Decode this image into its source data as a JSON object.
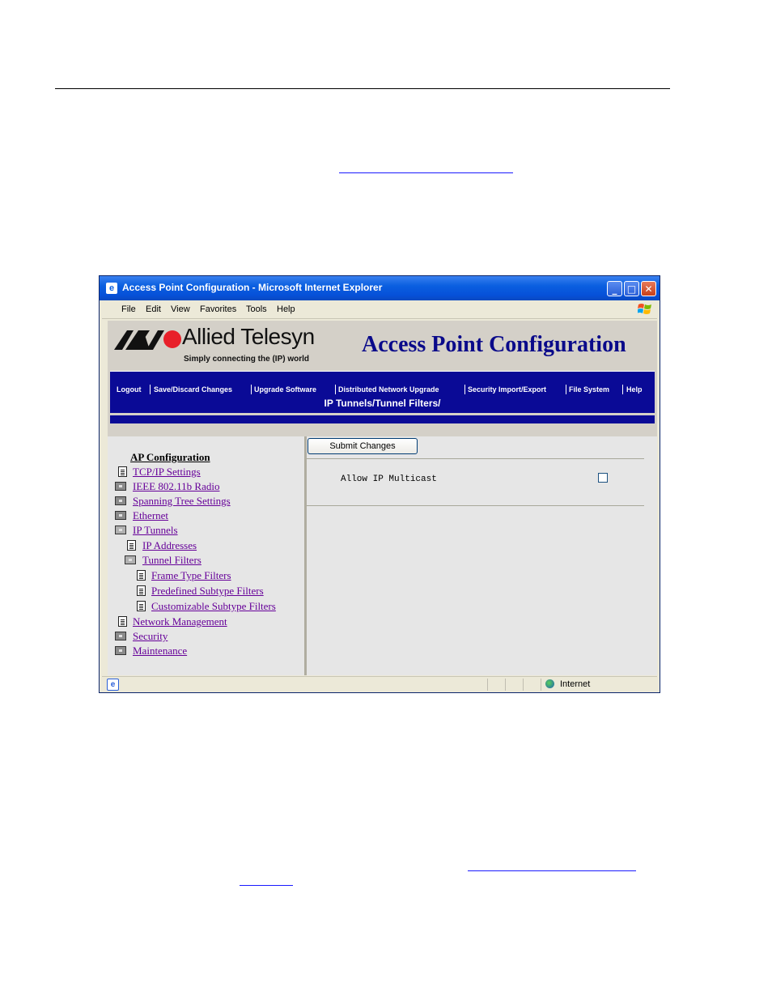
{
  "window": {
    "title": "Access Point Configuration - Microsoft Internet Explorer",
    "minimize_glyph": "_",
    "maximize_glyph": "□",
    "close_glyph": "✕"
  },
  "menubar": {
    "items": [
      "File",
      "Edit",
      "View",
      "Favorites",
      "Tools",
      "Help"
    ]
  },
  "header": {
    "brand": "Allied Telesyn",
    "tagline": "Simply connecting the (IP) world",
    "app_title": "Access Point Configuration"
  },
  "nav": {
    "items": [
      "Logout",
      "Save/Discard Changes",
      "Upgrade Software",
      "Distributed Network Upgrade",
      "Security Import/Export",
      "File System",
      "Help"
    ],
    "path": "IP Tunnels/Tunnel Filters/"
  },
  "tree": {
    "heading": "AP Configuration",
    "items": [
      {
        "label": "TCP/IP Settings",
        "icon": "document-icon"
      },
      {
        "label": "IEEE 802.11b Radio",
        "icon": "folder-closed-icon"
      },
      {
        "label": "Spanning Tree Settings",
        "icon": "folder-closed-icon"
      },
      {
        "label": "Ethernet",
        "icon": "folder-closed-icon"
      },
      {
        "label": "IP Tunnels",
        "icon": "folder-open-icon"
      },
      {
        "label": "IP Addresses",
        "icon": "document-icon"
      },
      {
        "label": "Tunnel Filters",
        "icon": "folder-open-icon"
      },
      {
        "label": "Frame Type Filters",
        "icon": "document-icon"
      },
      {
        "label": "Predefined Subtype Filters",
        "icon": "document-icon"
      },
      {
        "label": "Customizable Subtype Filters",
        "icon": "document-icon"
      },
      {
        "label": "Network Management",
        "icon": "document-icon"
      },
      {
        "label": "Security",
        "icon": "folder-closed-icon"
      },
      {
        "label": "Maintenance",
        "icon": "folder-closed-icon"
      }
    ]
  },
  "form": {
    "submit_label": "Submit Changes",
    "option_label": "Allow IP Multicast",
    "option_checked": false
  },
  "statusbar": {
    "zone": "Internet",
    "ie_glyph": "e"
  }
}
